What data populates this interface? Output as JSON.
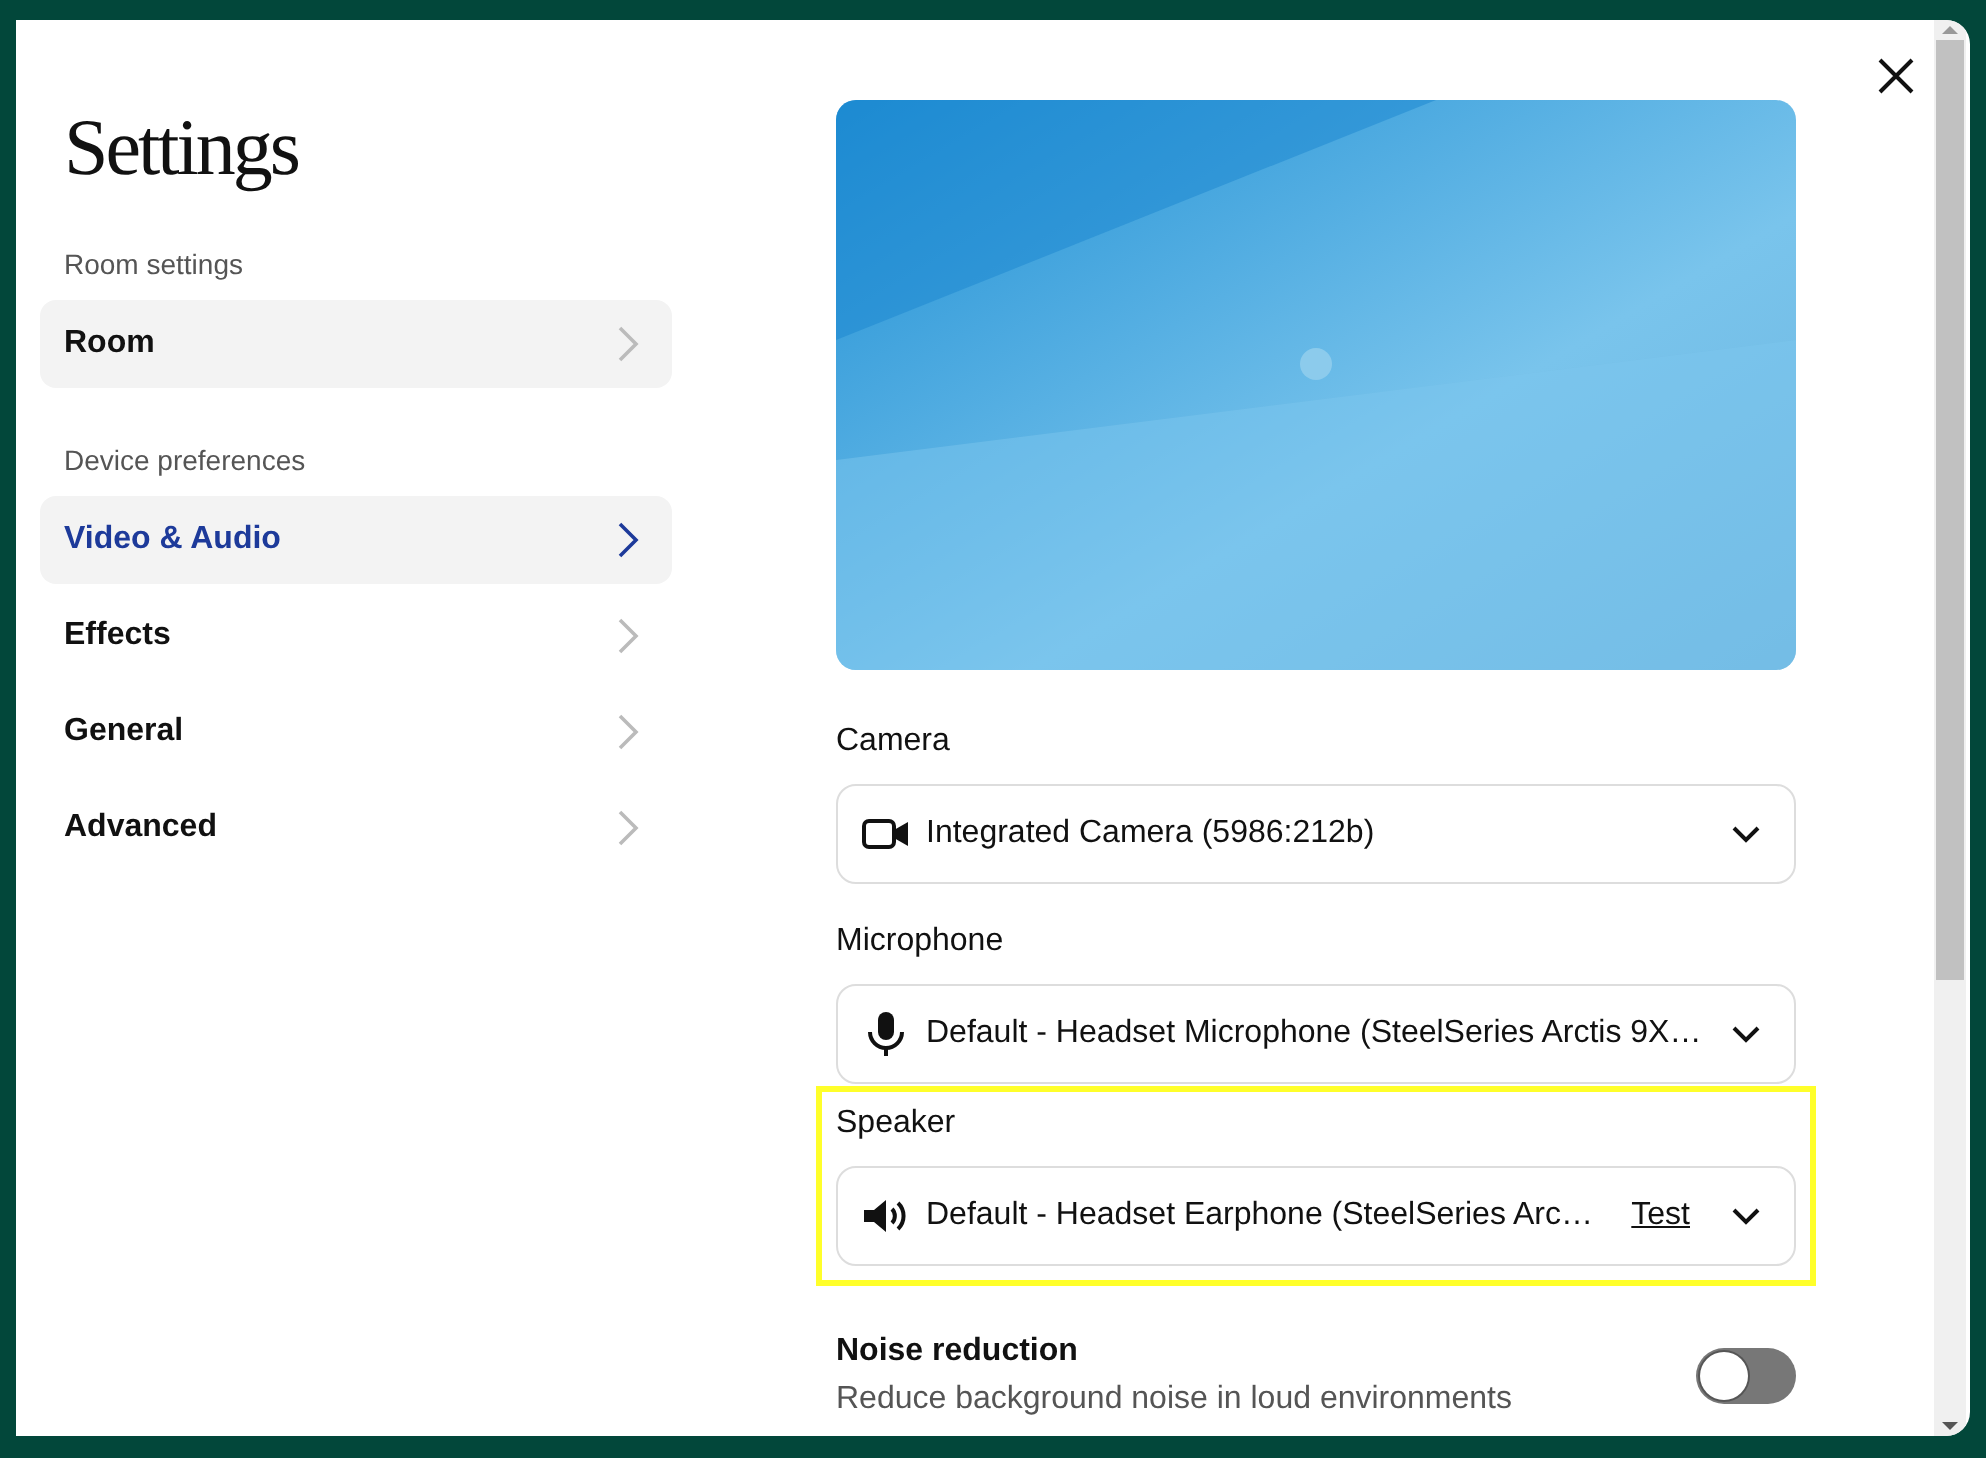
{
  "title": "Settings",
  "sidebar": {
    "sections": [
      {
        "heading": "Room settings",
        "items": [
          {
            "label": "Room",
            "selected": false
          }
        ]
      },
      {
        "heading": "Device preferences",
        "items": [
          {
            "label": "Video & Audio",
            "selected": true
          },
          {
            "label": "Effects",
            "selected": false
          },
          {
            "label": "General",
            "selected": false
          },
          {
            "label": "Advanced",
            "selected": false
          }
        ]
      }
    ]
  },
  "devices": [
    {
      "label": "Camera",
      "kind": "camera",
      "value": "Integrated Camera (5986:212b)",
      "highlighted": false
    },
    {
      "label": "Microphone",
      "kind": "microphone",
      "value": "Default - Headset Microphone (SteelSeries Arctis 9X…",
      "highlighted": false
    },
    {
      "label": "Speaker",
      "kind": "speaker",
      "value": "Default - Headset Earphone (SteelSeries Arc…",
      "test_link": "Test",
      "highlighted": true
    }
  ],
  "noise_reduction": {
    "title": "Noise reduction",
    "description": "Reduce background noise in loud environments",
    "on": false
  }
}
